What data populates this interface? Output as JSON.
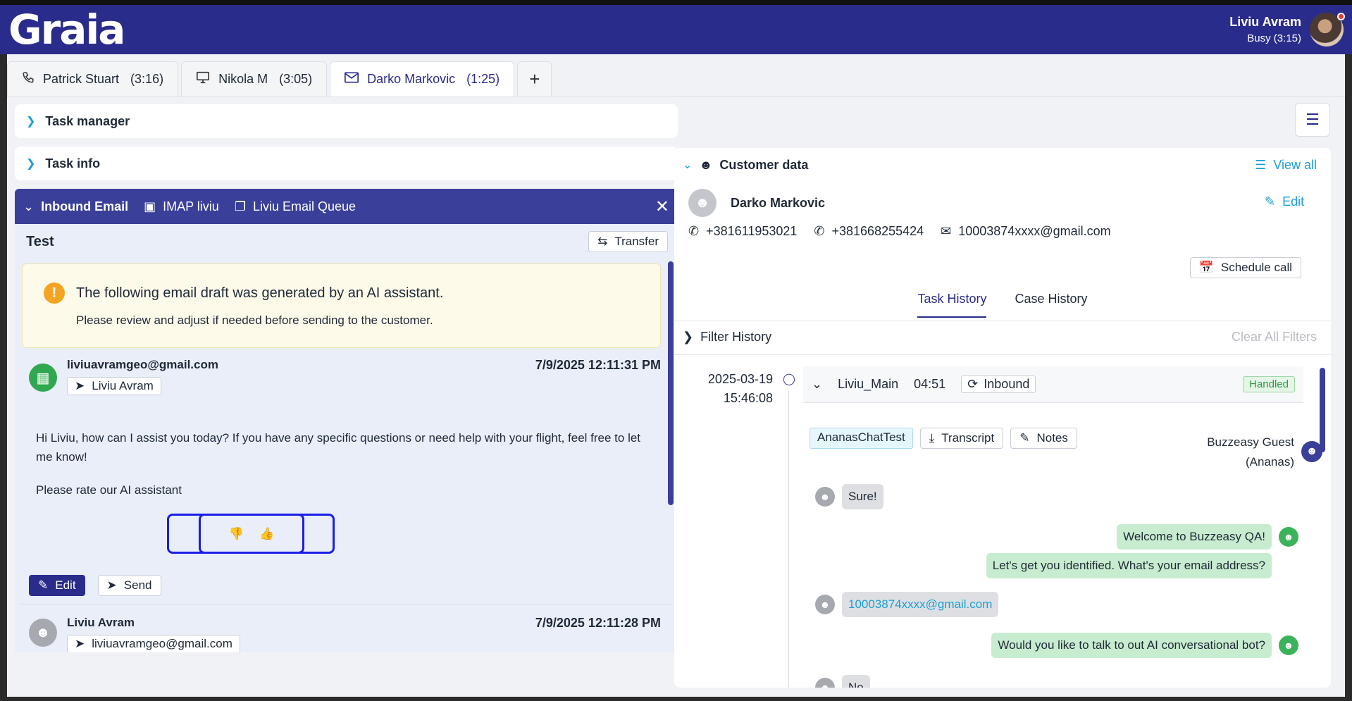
{
  "header": {
    "logo": "Graia",
    "user_name": "Liviu Avram",
    "user_status": "Busy (3:15)"
  },
  "tabs": [
    {
      "name": "Patrick Stuart",
      "time": "(3:16)",
      "icon": "phone-icon"
    },
    {
      "name": "Nikola M",
      "time": "(3:05)",
      "icon": "monitor-icon"
    },
    {
      "name": "Darko Markovic",
      "time": "(1:25)",
      "icon": "mail-icon"
    }
  ],
  "sections": {
    "task_manager": "Task manager",
    "task_info": "Task info"
  },
  "email": {
    "header_title": "Inbound Email",
    "account": "IMAP liviu",
    "queue": "Liviu Email Queue",
    "subject": "Test",
    "transfer_label": "Transfer",
    "ai_title": "The following email draft was generated by an AI assistant.",
    "ai_subtitle": "Please review and adjust if needed before sending to the customer.",
    "message1": {
      "sender": "liviuavramgeo@gmail.com",
      "date": "7/9/2025 12:11:31 PM",
      "to": "Liviu Avram",
      "body": "Hi Liviu, how can I assist you today? If you have any specific questions or need help with your flight, feel free to let me know!",
      "rate_text": "Please rate our AI assistant",
      "rate_down": "👎",
      "rate_up": "👍"
    },
    "edit_label": "Edit",
    "send_label": "Send",
    "message2": {
      "sender": "Liviu Avram",
      "date": "7/9/2025 12:11:28 PM",
      "to": "liviuavramgeo@gmail.com"
    }
  },
  "customer": {
    "title": "Customer data",
    "view_all": "View all",
    "name": "Darko Markovic",
    "edit_label": "Edit",
    "phone1": "+381611953021",
    "phone2": "+381668255424",
    "email": "10003874xxxx@gmail.com",
    "schedule_call": "Schedule call",
    "tabs": [
      "Task History",
      "Case History"
    ],
    "filter_history": "Filter History",
    "clear_filters": "Clear All Filters"
  },
  "history": {
    "date": "2025-03-19",
    "time": "15:46:08",
    "queue": "Liviu_Main",
    "duration": "04:51",
    "direction": "Inbound",
    "status": "Handled",
    "tag": "AnanasChatTest",
    "transcript": "Transcript",
    "notes": "Notes",
    "guest_line1": "Buzzeasy Guest",
    "guest_line2": "(Ananas)",
    "messages": [
      "Sure!",
      "Welcome to Buzzeasy QA!",
      "Let's get you identified. What's your email address?",
      "10003874xxxx@gmail.com",
      "Would you like to talk to out AI conversational bot?",
      "No"
    ]
  },
  "colors": {
    "header_bg": "#2a2c8c",
    "accent": "#1a9fd6",
    "email_header_bg": "#3a3f9a",
    "handled_green": "#2e9b45"
  }
}
